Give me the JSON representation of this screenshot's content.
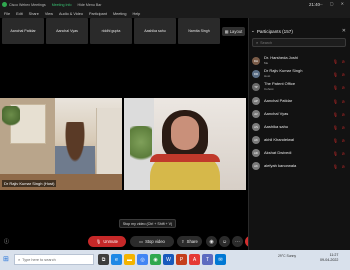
{
  "titlebar": {
    "app_title": "Cisco Webex Meetings",
    "meeting_info": "Meeting Info",
    "hide_menu": "Hide Menu Bar",
    "clock": "21:40",
    "window_controls": "— ▢ ✕"
  },
  "menu": [
    "File",
    "Edit",
    "Share",
    "View",
    "Audio & Video",
    "Participant",
    "Meeting",
    "Help"
  ],
  "tiles": [
    "Aanchal Patidar",
    "Aanchal Vyas",
    "riddhi gupta",
    "Aashika sahu",
    "Namita Singh"
  ],
  "layout_label": "Layout",
  "videos": {
    "left_name": "Dr Rajiv Kumar Singh (Host)",
    "right_name": ""
  },
  "tooltip": "Stop my video (Ctrl + Shift + V)",
  "controls": {
    "unmute": "Unmute",
    "stop_video": "Stop video",
    "share": "Share",
    "apps": "Apps"
  },
  "panel": {
    "title": "Participants (157)",
    "search_placeholder": "Search",
    "participants": [
      {
        "initials": "DH",
        "name": "Dr. Harsheda Joshi",
        "role": "Me",
        "color": "#7a5c48"
      },
      {
        "initials": "DR",
        "name": "Dr Rajiv Kumar Singh",
        "role": "Host",
        "color": "#5b6f86"
      },
      {
        "initials": "TP",
        "name": "The Patent Office",
        "role": "Cohost",
        "color": "#6a6a6a"
      },
      {
        "initials": "AP",
        "name": "Aanchal Patidar",
        "role": "",
        "color": "#7d7d7d"
      },
      {
        "initials": "AV",
        "name": "Aanchal Vyas",
        "role": "",
        "color": "#7d7d7d"
      },
      {
        "initials": "AS",
        "name": "Aashika sahu",
        "role": "",
        "color": "#7d7d7d"
      },
      {
        "initials": "AK",
        "name": "akhil Khandelwal",
        "role": "",
        "color": "#7d7d7d"
      },
      {
        "initials": "AD",
        "name": "Akshat Dwivedi",
        "role": "",
        "color": "#7d7d7d"
      },
      {
        "initials": "AK",
        "name": "alefyah kanorwala",
        "role": "",
        "color": "#7d7d7d"
      }
    ]
  },
  "taskbar": {
    "search_placeholder": "Type here to search",
    "weather": "29°C Sunny",
    "time": "11:27",
    "date": "09-04-2022"
  }
}
